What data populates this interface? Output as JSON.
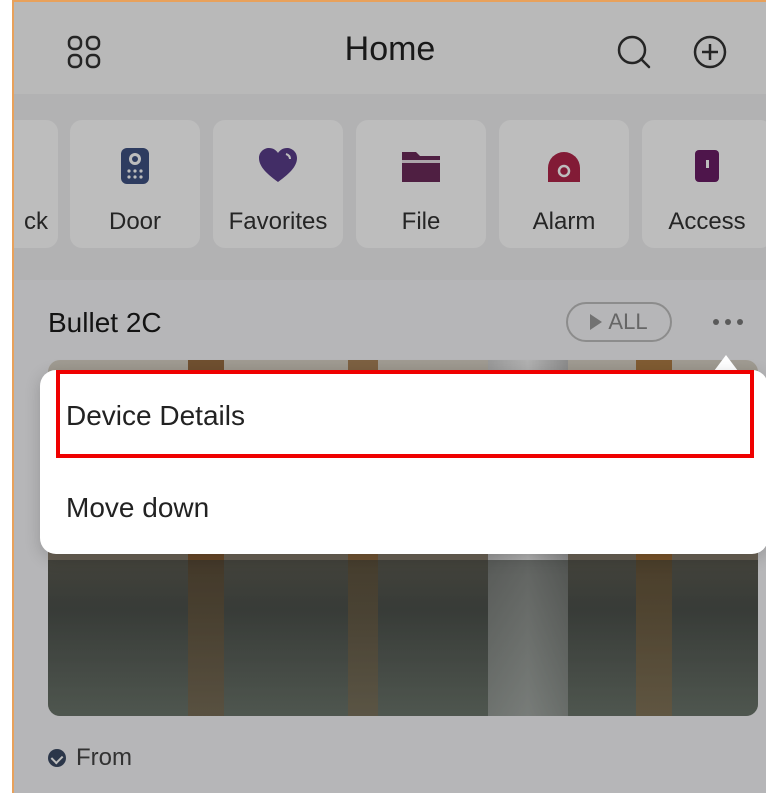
{
  "header": {
    "title": "Home"
  },
  "quick_access": [
    {
      "label": "ck",
      "icon": "lock-icon"
    },
    {
      "label": "Door",
      "icon": "door-intercom-icon"
    },
    {
      "label": "Favorites",
      "icon": "heart-icon"
    },
    {
      "label": "File",
      "icon": "folder-icon"
    },
    {
      "label": "Alarm",
      "icon": "alarm-icon"
    },
    {
      "label": "Access",
      "icon": "access-icon"
    }
  ],
  "device": {
    "name": "Bullet 2C",
    "all_label": "ALL",
    "from_label": "From"
  },
  "menu": {
    "items": [
      {
        "label": "Device Details"
      },
      {
        "label": "Move down"
      }
    ]
  },
  "colors": {
    "accent": "#6b2a5a",
    "alarm": "#b0254a",
    "highlight": "#ef0000"
  }
}
